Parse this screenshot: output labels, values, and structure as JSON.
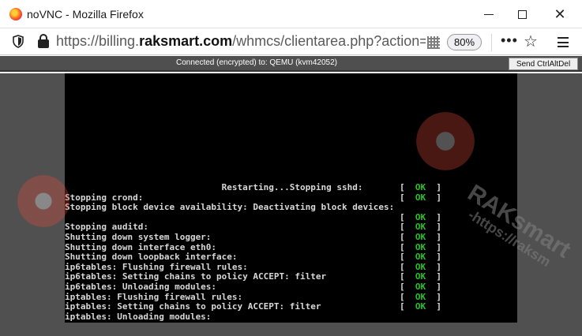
{
  "window": {
    "title": "noVNC - Mozilla Firefox",
    "controls": {
      "minimize": "minimize",
      "maximize": "maximize",
      "close": "✕"
    }
  },
  "urlbar": {
    "url_prefix": "https://billing.",
    "url_domain": "raksmart.com",
    "url_path": "/whmcs/clientarea.php?action=productdeta",
    "zoom": "80%",
    "more": "•••",
    "bookmark": "☆"
  },
  "vnc": {
    "status": "Connected (encrypted) to: QEMU (kvm42052)",
    "send_ctrl_alt_del": "Send CtrlAltDel"
  },
  "console": {
    "lines": [
      {
        "text": "                              Restarting...Stopping sshd:",
        "ok": true
      },
      {
        "text": "Stopping crond:",
        "ok": true
      },
      {
        "text": "Stopping block device availability: Deactivating block devices:",
        "ok": false
      },
      {
        "text": "",
        "ok": true
      },
      {
        "text": "Stopping auditd:",
        "ok": true
      },
      {
        "text": "Shutting down system logger:",
        "ok": true
      },
      {
        "text": "Shutting down interface eth0:",
        "ok": true
      },
      {
        "text": "Shutting down loopback interface:",
        "ok": true
      },
      {
        "text": "ip6tables: Flushing firewall rules:",
        "ok": true
      },
      {
        "text": "ip6tables: Setting chains to policy ACCEPT: filter",
        "ok": true
      },
      {
        "text": "ip6tables: Unloading modules:",
        "ok": true
      },
      {
        "text": "iptables: Flushing firewall rules:",
        "ok": true
      },
      {
        "text": "iptables: Setting chains to policy ACCEPT: filter",
        "ok": true
      },
      {
        "text": "iptables: Unloading modules:",
        "ok": false
      }
    ],
    "ok_label": "OK"
  },
  "watermark": {
    "brand": "RAKsmart",
    "url": "-https://raksm"
  },
  "colors": {
    "terminal_bg": "#000000",
    "terminal_text": "#d8d8d8",
    "ok_green": "#27c327",
    "vnc_bar": "#4f4f4f",
    "canvas_bg": "#505050"
  },
  "icons": {
    "browser": "firefox-logo-icon",
    "tracking": "shield-icon",
    "security": "lock-icon",
    "qr": "qr-code-icon",
    "menu": "hamburger-menu-icon"
  }
}
